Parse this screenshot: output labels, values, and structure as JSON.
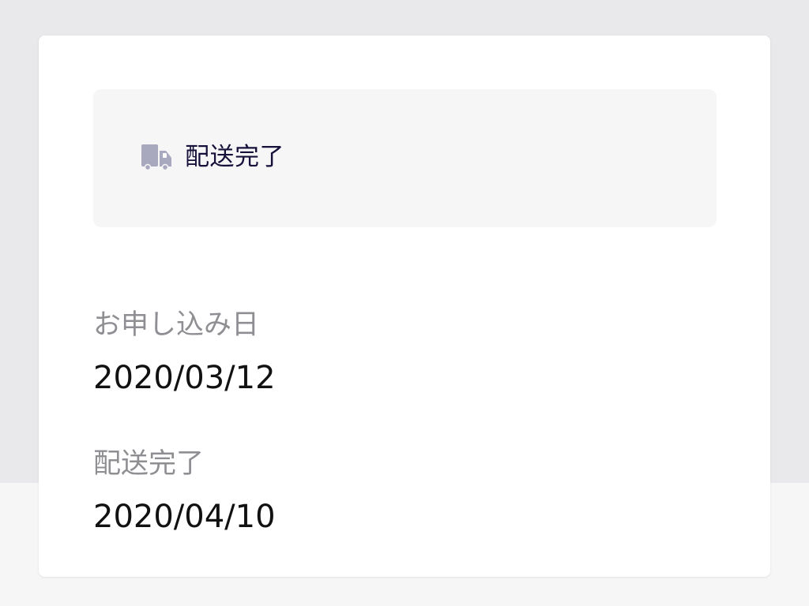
{
  "status": {
    "icon": "truck-icon",
    "label": "配送完了",
    "icon_color": "#a8a8be",
    "text_color": "#15113a"
  },
  "details": [
    {
      "label": "お申し込み日",
      "value": "2020/03/12"
    },
    {
      "label": "配送完了",
      "value": "2020/04/10"
    }
  ]
}
